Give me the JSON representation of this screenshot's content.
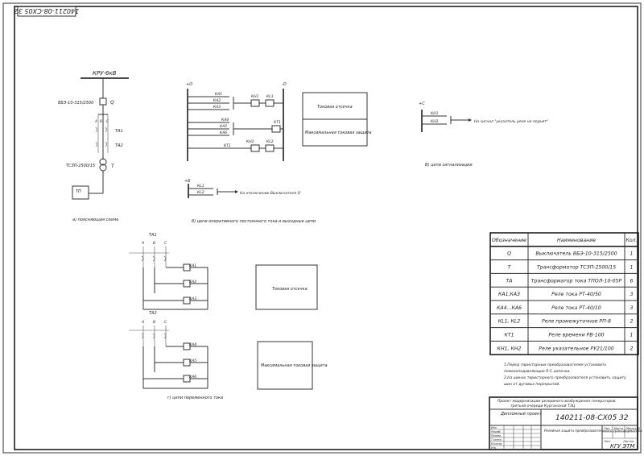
{
  "doc_code_rotated": "140211-08-СХ05 32",
  "left_scheme": {
    "bus_label": "КРУ-6кВ",
    "breaker_type": "ВБЭ-10-315/2500",
    "breaker_ref": "Q",
    "phases": [
      "А",
      "В",
      "С"
    ],
    "ta1": "ТА1",
    "ta2": "ТА2",
    "transformer_type": "ТСЗП-2500/15",
    "transformer_ref": "Т",
    "box_label": "ТП",
    "caption": "а) поясняющая схема"
  },
  "dc_scheme": {
    "plus": "+О",
    "minus": "-О",
    "contacts_top": [
      "КА1",
      "КА2",
      "КА3"
    ],
    "contacts_mid": [
      "КА4",
      "КА5",
      "КА6"
    ],
    "kh1": "КН1",
    "kl1": "КL1",
    "kt1": "КТ1",
    "kh2": "КН2",
    "kl2": "КL2",
    "kt1_contact": "КТ1",
    "box1": "Токовая отсечка",
    "box2": "Максимальная токовая защита",
    "sub_plus": "+Б",
    "sub_contacts": [
      "КL1",
      "КL2"
    ],
    "sub_target": "На отключение Выключателя Q",
    "caption": "б) цепи оперативного постоянного тока и выходные цепи"
  },
  "signal_scheme": {
    "plus": "+С",
    "contacts": [
      "КН1",
      "КН2"
    ],
    "target": "На сигнал \"указатель реле не поднят\"",
    "caption": "В) цепи сигнализации"
  },
  "ac_scheme": {
    "ta1": "ТА1",
    "ta2": "ТА2",
    "phases": [
      "А",
      "В",
      "С"
    ],
    "relays_top": [
      "КА1",
      "КА2",
      "КА3"
    ],
    "relays_bottom": [
      "КА4",
      "КА5",
      "КА6"
    ],
    "box1": "Токовая отсечка",
    "box2": "Максимальная токовая защита",
    "caption": "г) цепи переменного тока"
  },
  "table": {
    "headers": [
      "Обозначение",
      "Наименование",
      "Кол."
    ],
    "rows": [
      [
        "Q",
        "Выключатель ВБЭ-10-315/2500",
        "1"
      ],
      [
        "Т",
        "Трансформатор ТСЗП-2500/15",
        "1"
      ],
      [
        "ТА",
        "Трансформатор тока ТПОЛ-10-05Р",
        "6"
      ],
      [
        "КА1,КА3",
        "Реле тока РТ-40/50",
        "3"
      ],
      [
        "КА4...КА6",
        "Реле тока РТ-40/10",
        "3"
      ],
      [
        "КL1, КL2",
        "Реле промежуточное РП-8",
        "2"
      ],
      [
        "КТ1",
        "Реле времени РВ-100",
        "1"
      ],
      [
        "КН1, КН2",
        "Реле указательное РУ21/100",
        "2"
      ]
    ]
  },
  "notes": [
    "1.Перед тиристорным преобразователем установить",
    "помехоподавляющие R-C цепочки.",
    "2.На шинах тиристорного преобразователя установить защиту",
    "шин от дуговых перекрытий."
  ],
  "title_block": {
    "project": "Проект модернизации резервного возбуждения генераторов третьей очереди Курганской ТЭЦ",
    "doc_type": "Дипломный проект",
    "code": "140211-08-СХ05 32",
    "sheet_title": "Релейная защита преобразовательного трансформатора",
    "stage_header": [
      "Лит.",
      "Масса",
      "Масштаб"
    ],
    "sheet_row": [
      "Лист",
      "Листов"
    ],
    "org": "КГУ ЭТМ",
    "roles": [
      "Изм.",
      "Разраб.",
      "Провер.",
      "Т.контр.",
      "Н.контр.",
      "Утв."
    ]
  }
}
